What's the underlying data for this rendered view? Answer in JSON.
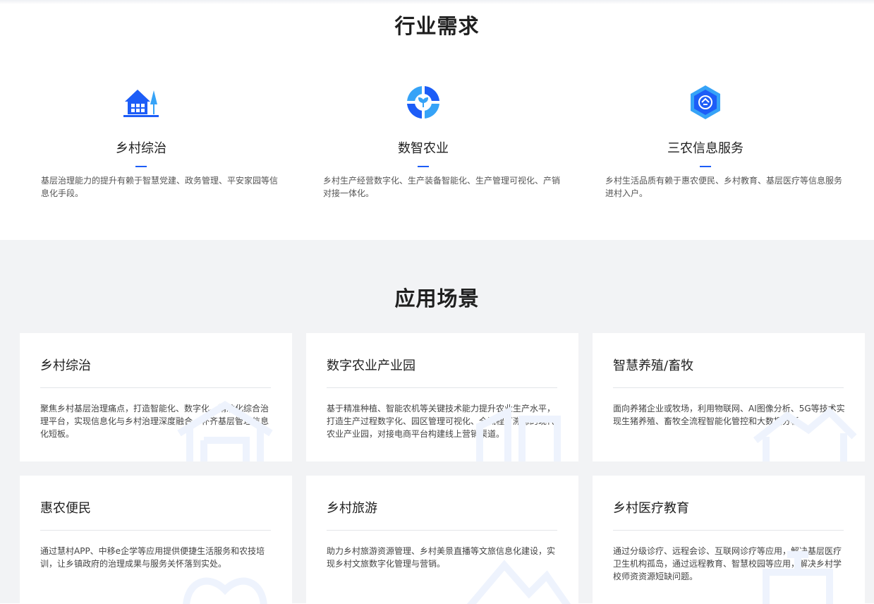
{
  "needs": {
    "title": "行业需求",
    "items": [
      {
        "name": "乡村综治",
        "desc": "基层治理能力的提升有赖于智慧党建、政务管理、平安家园等信息化手段。",
        "icon": "village-house-icon"
      },
      {
        "name": "数智农业",
        "desc": "乡村生产经营数字化、生产装备智能化、生产管理可视化、产销对接一体化。",
        "icon": "sprout-circle-icon"
      },
      {
        "name": "三农信息服务",
        "desc": "乡村生活品质有赖于惠农便民、乡村教育、基层医疗等信息服务进村入户。",
        "icon": "hexagon-service-icon"
      }
    ]
  },
  "scenes": {
    "title": "应用场景",
    "cards": [
      {
        "title": "乡村综治",
        "desc": "聚焦乡村基层治理痛点，打造智能化、数字化、精准化综合治理平台，实现信息化与乡村治理深度融合，补齐基层管理信息化短板。"
      },
      {
        "title": "数字农业产业园",
        "desc": "基于精准种植、智能农机等关键技术能力提升农业生产水平，打造生产过程数字化、园区管理可视化、全流程可溯源的现代农业产业园，对接电商平台构建线上营销渠道。"
      },
      {
        "title": "智慧养殖/畜牧",
        "desc": "面向养猪企业或牧场，利用物联网、AI图像分析、5G等技术实现生猪养殖、畜牧全流程智能化管控和大数据分析。"
      },
      {
        "title": "惠农便民",
        "desc": "通过慧村APP、中移e企学等应用提供便捷生活服务和农技培训，让乡镇政府的治理成果与服务关怀落到实处。"
      },
      {
        "title": "乡村旅游",
        "desc": "助力乡村旅游资源管理、乡村美景直播等文旅信息化建设，实现乡村文旅数字化管理与营销。"
      },
      {
        "title": "乡村医疗教育",
        "desc": "通过分级诊疗、远程会诊、互联网诊疗等应用，解决基层医疗卫生机构孤岛，通过远程教育、智慧校园等应用，解决乡村学校师资资源短缺问题。"
      }
    ]
  },
  "colors": {
    "accent": "#1d5df7",
    "light_accent": "#36a3f7",
    "bg_gray": "#f2f3f5"
  }
}
